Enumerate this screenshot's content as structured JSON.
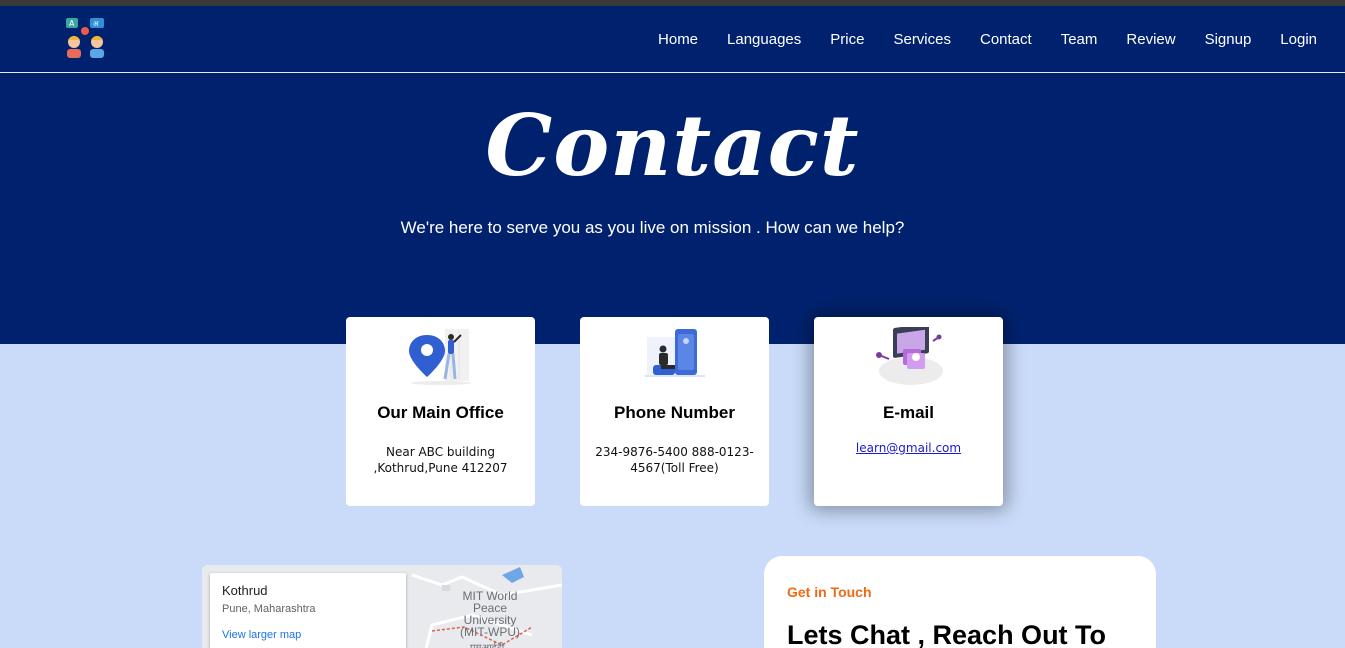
{
  "nav": {
    "links": [
      "Home",
      "Languages",
      "Price",
      "Services",
      "Contact",
      "Team",
      "Review",
      "Signup",
      "Login"
    ]
  },
  "hero": {
    "title": "Contact",
    "subtitle": "We're here to serve you as you live on mission . How can we help?"
  },
  "cards": [
    {
      "title": "Our Main Office",
      "body": "Near ABC building ,Kothrud,Pune 412207",
      "icon": "location-pin-illustration"
    },
    {
      "title": "Phone Number",
      "body": "234-9876-5400 888-0123-4567(Toll Free)",
      "icon": "phone-illustration"
    },
    {
      "title": "E-mail",
      "body": "learn@gmail.com",
      "icon": "email-laptop-illustration"
    }
  ],
  "map": {
    "place": "Kothrud",
    "region": "Pune, Maharashtra",
    "view_link": "View larger map",
    "label": "MIT World Peace University (MIT-WPU)",
    "label_local": "एमआईटी"
  },
  "contact_form": {
    "eyebrow": "Get in Touch",
    "heading": "Lets Chat , Reach Out To"
  },
  "colors": {
    "hero_bg": "#00226e",
    "page_bg": "#c9dbf9",
    "accent_orange": "#f06a15",
    "link_blue": "#1a1ad6"
  }
}
